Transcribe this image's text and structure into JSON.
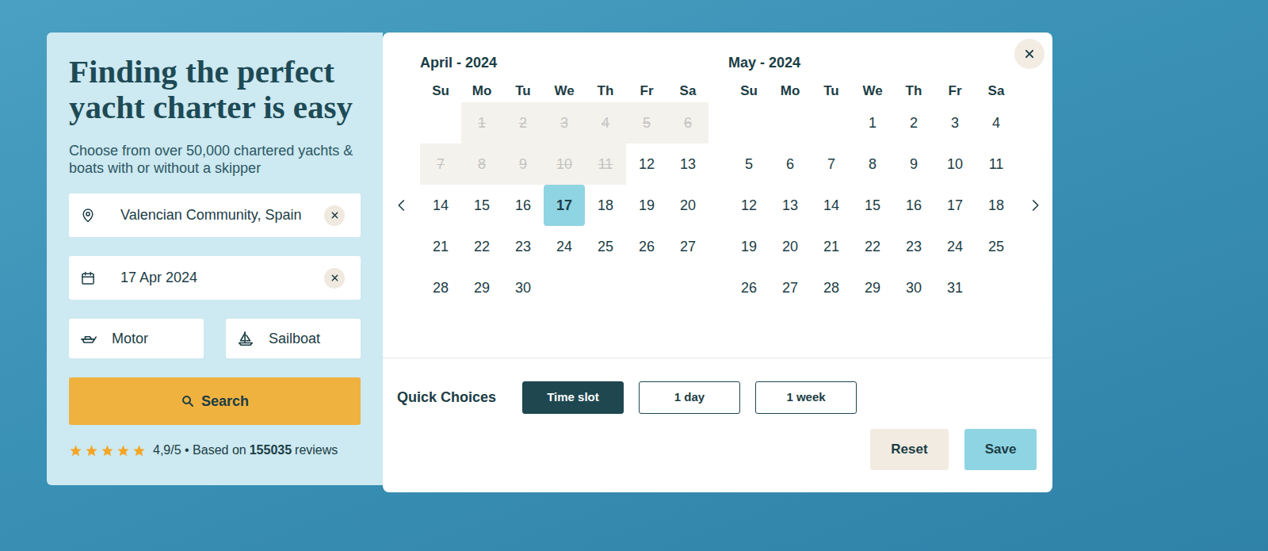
{
  "hero": {
    "title": "Finding the perfect yacht charter is easy",
    "subtitle": "Choose from over 50,000 chartered yachts & boats with or without a skipper"
  },
  "location": {
    "value": "Valencian Community, Spain"
  },
  "date": {
    "value": "17 Apr 2024"
  },
  "boat_types": [
    {
      "label": "Motor",
      "kind": "motor",
      "selected": false
    },
    {
      "label": "Sailboat",
      "kind": "sail",
      "selected": false
    }
  ],
  "search_button": "Search",
  "rating": {
    "stars": 5,
    "score": "4,9/5 • Based on",
    "count": "155035",
    "suffix": "reviews"
  },
  "calendar": {
    "months": [
      {
        "title": "April - 2024",
        "weekdays": [
          "Su",
          "Mo",
          "Tu",
          "We",
          "Th",
          "Fr",
          "Sa"
        ],
        "offset": 1,
        "days": [
          {
            "label": "1",
            "disabled": true,
            "selected": false
          },
          {
            "label": "2",
            "disabled": true,
            "selected": false
          },
          {
            "label": "3",
            "disabled": true,
            "selected": false
          },
          {
            "label": "4",
            "disabled": true,
            "selected": false
          },
          {
            "label": "5",
            "disabled": true,
            "selected": false
          },
          {
            "label": "6",
            "disabled": true,
            "selected": false
          },
          {
            "label": "7",
            "disabled": true,
            "selected": false
          },
          {
            "label": "8",
            "disabled": true,
            "selected": false
          },
          {
            "label": "9",
            "disabled": true,
            "selected": false
          },
          {
            "label": "10",
            "disabled": true,
            "selected": false
          },
          {
            "label": "11",
            "disabled": true,
            "selected": false
          },
          {
            "label": "12",
            "disabled": false,
            "selected": false
          },
          {
            "label": "13",
            "disabled": false,
            "selected": false
          },
          {
            "label": "14",
            "disabled": false,
            "selected": false
          },
          {
            "label": "15",
            "disabled": false,
            "selected": false
          },
          {
            "label": "16",
            "disabled": false,
            "selected": false
          },
          {
            "label": "17",
            "disabled": false,
            "selected": true
          },
          {
            "label": "18",
            "disabled": false,
            "selected": false
          },
          {
            "label": "19",
            "disabled": false,
            "selected": false
          },
          {
            "label": "20",
            "disabled": false,
            "selected": false
          },
          {
            "label": "21",
            "disabled": false,
            "selected": false
          },
          {
            "label": "22",
            "disabled": false,
            "selected": false
          },
          {
            "label": "23",
            "disabled": false,
            "selected": false
          },
          {
            "label": "24",
            "disabled": false,
            "selected": false
          },
          {
            "label": "25",
            "disabled": false,
            "selected": false
          },
          {
            "label": "26",
            "disabled": false,
            "selected": false
          },
          {
            "label": "27",
            "disabled": false,
            "selected": false
          },
          {
            "label": "28",
            "disabled": false,
            "selected": false
          },
          {
            "label": "29",
            "disabled": false,
            "selected": false
          },
          {
            "label": "30",
            "disabled": false,
            "selected": false
          }
        ]
      },
      {
        "title": "May - 2024",
        "weekdays": [
          "Su",
          "Mo",
          "Tu",
          "We",
          "Th",
          "Fr",
          "Sa"
        ],
        "offset": 3,
        "days": [
          {
            "label": "1",
            "disabled": false,
            "selected": false
          },
          {
            "label": "2",
            "disabled": false,
            "selected": false
          },
          {
            "label": "3",
            "disabled": false,
            "selected": false
          },
          {
            "label": "4",
            "disabled": false,
            "selected": false
          },
          {
            "label": "5",
            "disabled": false,
            "selected": false
          },
          {
            "label": "6",
            "disabled": false,
            "selected": false
          },
          {
            "label": "7",
            "disabled": false,
            "selected": false
          },
          {
            "label": "8",
            "disabled": false,
            "selected": false
          },
          {
            "label": "9",
            "disabled": false,
            "selected": false
          },
          {
            "label": "10",
            "disabled": false,
            "selected": false
          },
          {
            "label": "11",
            "disabled": false,
            "selected": false
          },
          {
            "label": "12",
            "disabled": false,
            "selected": false
          },
          {
            "label": "13",
            "disabled": false,
            "selected": false
          },
          {
            "label": "14",
            "disabled": false,
            "selected": false
          },
          {
            "label": "15",
            "disabled": false,
            "selected": false
          },
          {
            "label": "16",
            "disabled": false,
            "selected": false
          },
          {
            "label": "17",
            "disabled": false,
            "selected": false
          },
          {
            "label": "18",
            "disabled": false,
            "selected": false
          },
          {
            "label": "19",
            "disabled": false,
            "selected": false
          },
          {
            "label": "20",
            "disabled": false,
            "selected": false
          },
          {
            "label": "21",
            "disabled": false,
            "selected": false
          },
          {
            "label": "22",
            "disabled": false,
            "selected": false
          },
          {
            "label": "23",
            "disabled": false,
            "selected": false
          },
          {
            "label": "24",
            "disabled": false,
            "selected": false
          },
          {
            "label": "25",
            "disabled": false,
            "selected": false
          },
          {
            "label": "26",
            "disabled": false,
            "selected": false
          },
          {
            "label": "27",
            "disabled": false,
            "selected": false
          },
          {
            "label": "28",
            "disabled": false,
            "selected": false
          },
          {
            "label": "29",
            "disabled": false,
            "selected": false
          },
          {
            "label": "30",
            "disabled": false,
            "selected": false
          },
          {
            "label": "31",
            "disabled": false,
            "selected": false
          }
        ]
      }
    ]
  },
  "quick_choices": {
    "label": "Quick Choices",
    "options": [
      {
        "label": "Time slot",
        "selected": true
      },
      {
        "label": "1 day",
        "selected": false
      },
      {
        "label": "1 week",
        "selected": false
      }
    ]
  },
  "buttons": [
    {
      "label": "Reset",
      "kind": "secondary"
    },
    {
      "label": "Save",
      "kind": "primary"
    }
  ]
}
